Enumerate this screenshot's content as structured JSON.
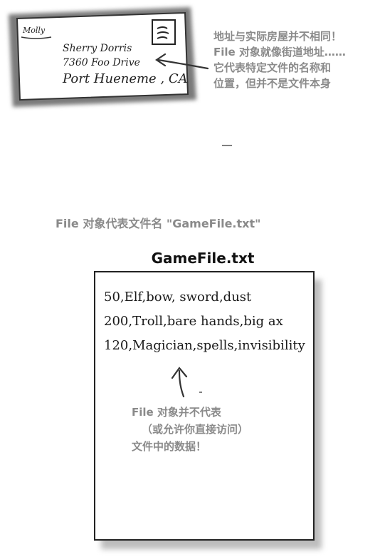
{
  "envelope": {
    "sender": "Molly",
    "recipient_name": "Sherry Dorris",
    "street": "7360 Foo Drive",
    "city": "Port Hueneme , CA"
  },
  "envelope_note": {
    "lines": [
      "地址与实际房屋并不相同！",
      "File 对象就像街道地址……",
      "它代表特定文件的名称和",
      "位置，但并不是文件本身"
    ]
  },
  "filename_caption": "File 对象代表文件名 \"GameFile.txt\"",
  "file": {
    "title": "GameFile.txt",
    "lines": [
      "50,Elf,bow, sword,dust",
      "200,Troll,bare hands,big ax",
      "120,Magician,spells,invisibility"
    ]
  },
  "file_note": {
    "lines": [
      "File 对象并不代表",
      "（或允许你直接访问）",
      "文件中的数据！"
    ]
  }
}
